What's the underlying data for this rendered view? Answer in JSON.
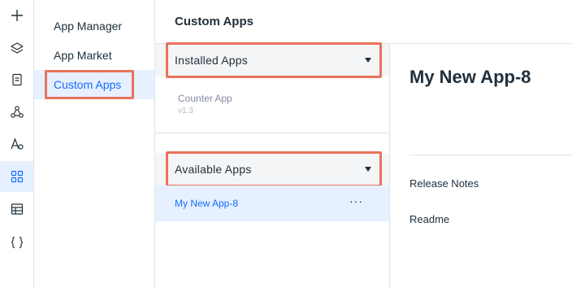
{
  "rail": {
    "items": [
      {
        "icon": "plus-icon"
      },
      {
        "icon": "layers-icon"
      },
      {
        "icon": "page-icon"
      },
      {
        "icon": "connections-icon"
      },
      {
        "icon": "fonts-icon"
      },
      {
        "icon": "apps-grid-icon",
        "active": true
      },
      {
        "icon": "table-icon"
      },
      {
        "icon": "code-braces-icon"
      }
    ]
  },
  "menu": {
    "items": [
      {
        "label": "App Manager"
      },
      {
        "label": "App Market"
      },
      {
        "label": "Custom Apps",
        "active": true
      }
    ]
  },
  "header": {
    "title": "Custom Apps"
  },
  "installed": {
    "label": "Installed Apps",
    "apps": [
      {
        "name": "Counter App",
        "version": "v1.3"
      }
    ]
  },
  "available": {
    "label": "Available Apps",
    "apps": [
      {
        "name": "My New App-8",
        "more": "···"
      }
    ]
  },
  "detail": {
    "title": "My New App-8",
    "links": [
      "Release Notes",
      "Readme"
    ]
  },
  "colors": {
    "accent": "#116dff",
    "active_bg": "#e7f0ff",
    "highlight": "#e8735a"
  }
}
